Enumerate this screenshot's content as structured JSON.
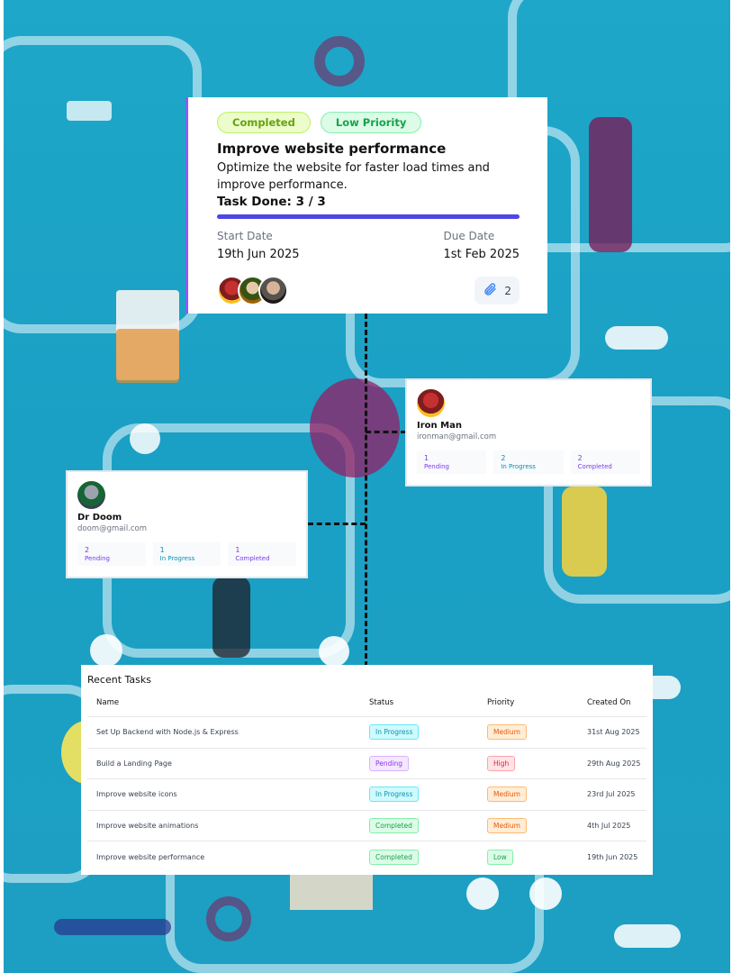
{
  "task_card": {
    "status": "Completed",
    "priority": "Low Priority",
    "title": "Improve website performance",
    "description": "Optimize the website for faster load times and improve performance.",
    "task_done": "Task Done: 3 / 3",
    "progress_fraction": 1.0,
    "start_label": "Start Date",
    "start_value": "19th Jun 2025",
    "due_label": "Due Date",
    "due_value": "1st Feb 2025",
    "attachments": "2",
    "attachment_icon": "paperclip-icon"
  },
  "users": [
    {
      "name": "Iron Man",
      "email": "ironman@gmail.com",
      "stats": [
        {
          "value": "1",
          "label": "Pending"
        },
        {
          "value": "2",
          "label": "In Progress"
        },
        {
          "value": "2",
          "label": "Completed"
        }
      ]
    },
    {
      "name": "Dr Doom",
      "email": "doom@gmail.com",
      "stats": [
        {
          "value": "2",
          "label": "Pending"
        },
        {
          "value": "1",
          "label": "In Progress"
        },
        {
          "value": "1",
          "label": "Completed"
        }
      ]
    }
  ],
  "recent": {
    "title": "Recent Tasks",
    "headers": [
      "Name",
      "Status",
      "Priority",
      "Created On"
    ],
    "rows": [
      {
        "name": "Set Up Backend with Node.js & Express",
        "status": "In Progress",
        "priority": "Medium",
        "created": "31st Aug 2025"
      },
      {
        "name": "Build a Landing Page",
        "status": "Pending",
        "priority": "High",
        "created": "29th Aug 2025"
      },
      {
        "name": "Improve website icons",
        "status": "In Progress",
        "priority": "Medium",
        "created": "23rd Jul 2025"
      },
      {
        "name": "Improve website animations",
        "status": "Completed",
        "priority": "Medium",
        "created": "4th Jul 2025"
      },
      {
        "name": "Improve website performance",
        "status": "Completed",
        "priority": "Low",
        "created": "19th Jun 2025"
      }
    ]
  },
  "colors": {
    "accent": "#4f46e5",
    "card_border": "#8b5cf6",
    "background": "#1ea7c9"
  }
}
